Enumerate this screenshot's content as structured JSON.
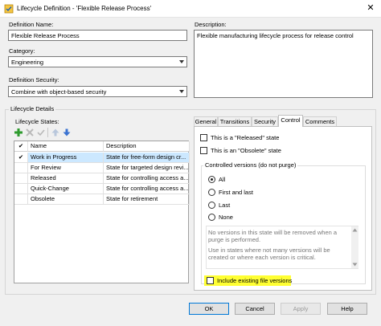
{
  "window": {
    "title": "Lifecycle Definition - 'Flexible Release Process'",
    "close_glyph": "✕"
  },
  "definition_name": {
    "label": "Definition Name:",
    "value": "Flexible Release Process"
  },
  "category": {
    "label": "Category:",
    "value": "Engineering"
  },
  "security": {
    "label": "Definition Security:",
    "value": "Combine with object-based security"
  },
  "description": {
    "label": "Description:",
    "value": "Flexible manufacturing lifecycle process for release control"
  },
  "lifecycle_details": {
    "label": "Lifecycle Details",
    "states_label": "Lifecycle States:",
    "columns": [
      "Name",
      "Description"
    ],
    "rows": [
      {
        "name": "Work in Progress",
        "description": "State for free-form design cr...",
        "checked": true,
        "selected": true
      },
      {
        "name": "For Review",
        "description": "State for targeted design revi...",
        "checked": false,
        "selected": false
      },
      {
        "name": "Released",
        "description": "State for controlling access a...",
        "checked": false,
        "selected": false
      },
      {
        "name": "Quick-Change",
        "description": "State for controlling access a...",
        "checked": false,
        "selected": false
      },
      {
        "name": "Obsolete",
        "description": "State for retirement",
        "checked": false,
        "selected": false
      }
    ],
    "check_glyph": "✔"
  },
  "tabs": [
    {
      "label": "General",
      "active": false
    },
    {
      "label": "Transitions",
      "active": false
    },
    {
      "label": "Security",
      "active": false
    },
    {
      "label": "Control",
      "active": true
    },
    {
      "label": "Comments",
      "active": false
    }
  ],
  "control": {
    "released_label": "This is a \"Released\" state",
    "obsolete_label": "This is an \"Obsolete\" state",
    "versions_group_label": "Controlled versions (do not purge)",
    "radios": [
      {
        "label": "All",
        "selected": true
      },
      {
        "label": "First and last",
        "selected": false
      },
      {
        "label": "Last",
        "selected": false
      },
      {
        "label": "None",
        "selected": false
      }
    ],
    "info_line1": "No versions in this state will be removed when a purge is performed.",
    "info_line2": "Use in states where not many versions will be created or where each version is critical.",
    "include_file_versions_label": "Include existing file versions"
  },
  "buttons": {
    "ok": "OK",
    "cancel": "Cancel",
    "apply": "Apply",
    "help": "Help"
  },
  "colors": {
    "accent": "#0078d7",
    "selection": "#cce8ff",
    "highlight": "#ffff33",
    "add_icon": "#2e9b2e",
    "up_arrow": "#5b8fd9"
  }
}
